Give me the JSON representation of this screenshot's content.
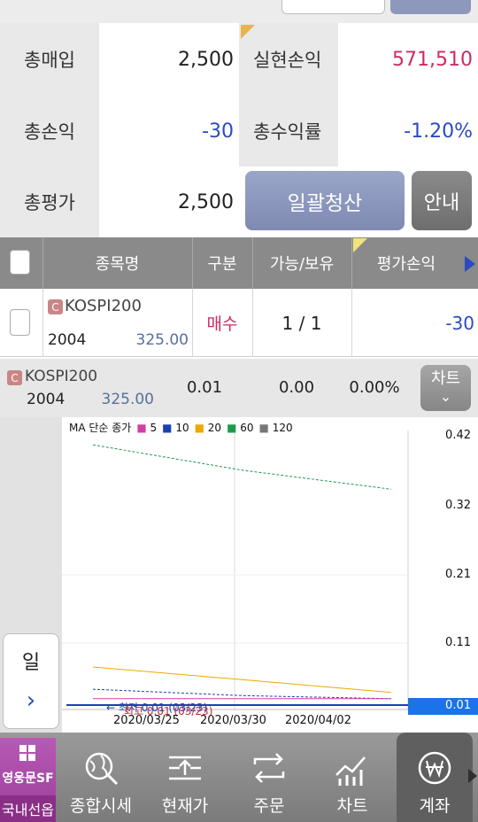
{
  "summary": {
    "total_buy_label": "총매입",
    "total_buy_value": "2,500",
    "realized_pl_label": "실현손익",
    "realized_pl_value": "571,510",
    "total_pl_label": "총손익",
    "total_pl_value": "-30",
    "total_return_label": "총수익률",
    "total_return_value": "-1.20%",
    "total_eval_label": "총평가",
    "total_eval_value": "2,500",
    "settle_all_label": "일괄청산",
    "info_label": "안내"
  },
  "table": {
    "headers": [
      "종목명",
      "구분",
      "가능/보유",
      "평가손익"
    ],
    "rows": [
      {
        "badge": "C",
        "name": "KOSPI200",
        "month": "2004",
        "strike": "325.00",
        "side": "매수",
        "avail_hold": "1 / 1",
        "pl": "-30"
      }
    ]
  },
  "quote": {
    "badge": "C",
    "name": "KOSPI200",
    "month": "2004",
    "strike": "325.00",
    "price": "0.01",
    "change": "0.00",
    "change_pct": "0.00%",
    "chart_button": "차트"
  },
  "chart": {
    "legend_title": "MA 단순 종가",
    "legend": [
      {
        "label": "5",
        "color": "#d03fa8"
      },
      {
        "label": "10",
        "color": "#1e3fb0"
      },
      {
        "label": "20",
        "color": "#f0a800"
      },
      {
        "label": "60",
        "color": "#1f9a4a"
      },
      {
        "label": "120",
        "color": "#777777"
      }
    ],
    "y_ticks": [
      "0.42",
      "0.32",
      "0.21",
      "0.11"
    ],
    "current_price_tag": "0.01",
    "x_ticks": [
      "2020/03/25",
      "2020/03/30",
      "2020/04/02"
    ],
    "low_label": "최저 0.01 (03/23)",
    "high_label": "최고 0.01 (03/23)",
    "period_label": "일"
  },
  "chart_data": {
    "type": "line",
    "x": [
      "2020/03/25",
      "2020/03/30",
      "2020/04/02"
    ],
    "ylim": [
      0.0,
      0.42
    ],
    "series": [
      {
        "name": "60",
        "color": "#1f9a4a",
        "values": [
          0.41,
          0.37,
          0.34
        ]
      },
      {
        "name": "20",
        "color": "#f0a800",
        "values": [
          0.06,
          0.04,
          0.02
        ]
      },
      {
        "name": "10",
        "color": "#1e3fb0",
        "values": [
          0.025,
          0.015,
          0.01
        ]
      },
      {
        "name": "5",
        "color": "#d03fa8",
        "values": [
          0.01,
          0.01,
          0.01
        ]
      }
    ]
  },
  "nav": {
    "brand": "영웅문SF",
    "brand_sub": "국내선옵",
    "items": [
      {
        "label": "종합시세",
        "icon": "globe-search-icon"
      },
      {
        "label": "현재가",
        "icon": "price-list-icon"
      },
      {
        "label": "주문",
        "icon": "exchange-arrows-icon"
      },
      {
        "label": "차트",
        "icon": "chart-trend-icon"
      },
      {
        "label": "계좌",
        "icon": "won-coin-icon"
      }
    ]
  }
}
